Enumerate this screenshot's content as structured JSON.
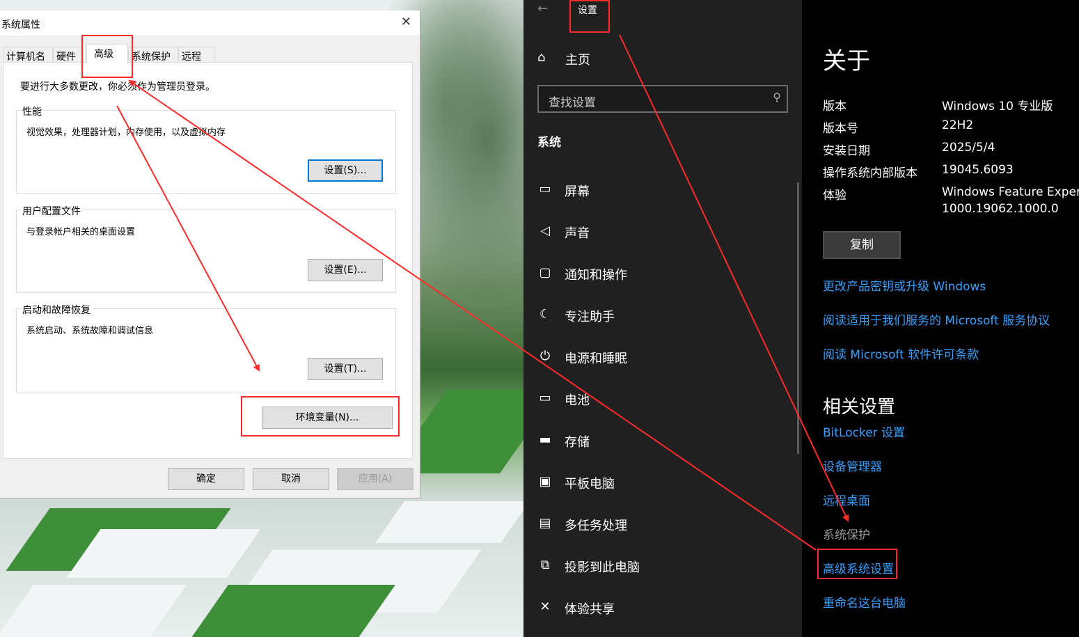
{
  "dialog": {
    "title": "系统属性",
    "close": "✕",
    "tabs": [
      "计算机名",
      "硬件",
      "高级",
      "系统保护",
      "远程"
    ],
    "notice": "要进行大多数更改，你必须作为管理员登录。",
    "groups": [
      {
        "label": "性能",
        "desc": "视觉效果，处理器计划，内存使用，以及虚拟内存",
        "button": "设置(S)..."
      },
      {
        "label": "用户配置文件",
        "desc": "与登录帐户相关的桌面设置",
        "button": "设置(E)..."
      },
      {
        "label": "启动和故障恢复",
        "desc": "系统启动、系统故障和调试信息",
        "button": "设置(T)..."
      }
    ],
    "env_button": "环境变量(N)...",
    "ok": "确定",
    "cancel": "取消",
    "apply": "应用(A)"
  },
  "settings": {
    "title": "设置",
    "home": "主页",
    "search_placeholder": "查找设置",
    "section": "系统",
    "nav_items": [
      {
        "label": "屏幕",
        "icon": "monitor-icon"
      },
      {
        "label": "声音",
        "icon": "speaker-icon"
      },
      {
        "label": "通知和操作",
        "icon": "notification-icon"
      },
      {
        "label": "专注助手",
        "icon": "moon-icon"
      },
      {
        "label": "电源和睡眠",
        "icon": "power-icon"
      },
      {
        "label": "电池",
        "icon": "battery-icon"
      },
      {
        "label": "存储",
        "icon": "storage-icon"
      },
      {
        "label": "平板电脑",
        "icon": "tablet-icon"
      },
      {
        "label": "多任务处理",
        "icon": "multitask-icon"
      },
      {
        "label": "投影到此电脑",
        "icon": "project-icon"
      },
      {
        "label": "体验共享",
        "icon": "share-icon"
      }
    ]
  },
  "about": {
    "title": "关于",
    "specs": [
      {
        "key": "版本",
        "value": "Windows 10 专业版"
      },
      {
        "key": "版本号",
        "value": "22H2"
      },
      {
        "key": "安装日期",
        "value": "2025/5/4"
      },
      {
        "key": "操作系统内部版本",
        "value": "19045.6093"
      },
      {
        "key": "体验",
        "value": "Windows Feature Experience Pack"
      }
    ],
    "experience_version": "1000.19062.1000.0",
    "copy_button": "复制",
    "links": [
      "更改产品密钥或升级 Windows",
      "阅读适用于我们服务的 Microsoft 服务协议",
      "阅读 Microsoft 软件许可条款"
    ],
    "related_title": "相关设置",
    "related_links": [
      "BitLocker 设置",
      "设备管理器",
      "远程桌面",
      "系统保护",
      "高级系统设置",
      "重命名这台电脑"
    ]
  },
  "colors": {
    "annotation": "#ff2a2a",
    "link": "#3aa0ff"
  }
}
